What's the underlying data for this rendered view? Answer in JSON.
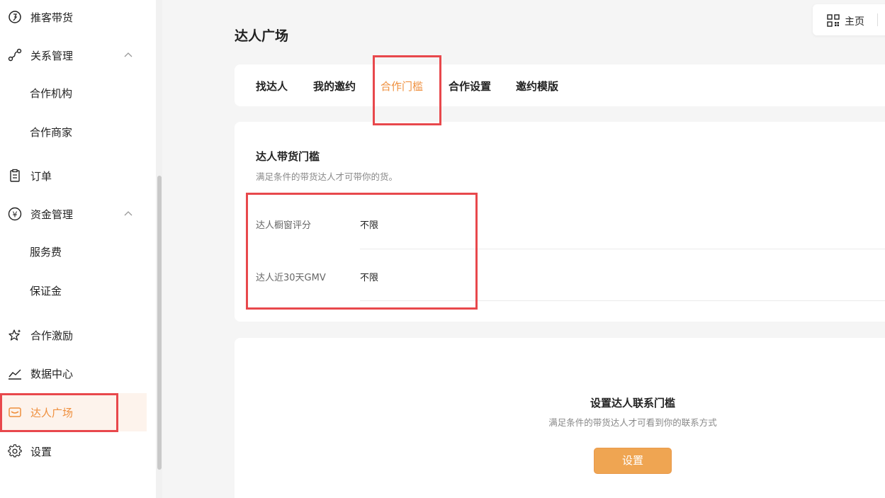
{
  "sidebar": {
    "items": [
      {
        "label": "推客带货",
        "icon": "bulb-icon"
      },
      {
        "label": "关系管理",
        "icon": "relation-icon"
      },
      {
        "label": "合作机构"
      },
      {
        "label": "合作商家"
      },
      {
        "label": "订单",
        "icon": "clipboard-icon"
      },
      {
        "label": "资金管理",
        "icon": "yen-icon"
      },
      {
        "label": "服务费"
      },
      {
        "label": "保证金"
      },
      {
        "label": "合作激励",
        "icon": "star-sparkle-icon"
      },
      {
        "label": "数据中心",
        "icon": "trend-icon"
      },
      {
        "label": "达人广场",
        "icon": "mail-icon",
        "active": true
      },
      {
        "label": "设置",
        "icon": "gear-icon"
      }
    ]
  },
  "header": {
    "title": "达人广场",
    "home_label": "主页"
  },
  "tabs": [
    {
      "label": "找达人"
    },
    {
      "label": "我的邀约"
    },
    {
      "label": "合作门槛",
      "active": true
    },
    {
      "label": "合作设置"
    },
    {
      "label": "邀约模版"
    }
  ],
  "threshold": {
    "title": "达人带货门槛",
    "description": "满足条件的带货达人才可带你的货。",
    "rows": [
      {
        "label": "达人橱窗评分",
        "value": "不限"
      },
      {
        "label": "达人近30天GMV",
        "value": "不限"
      }
    ]
  },
  "contact": {
    "title": "设置达人联系门槛",
    "description": "满足条件的带货达人才可看到你的联系方式",
    "button_label": "设置"
  },
  "colors": {
    "accent": "#ef8f3d",
    "button": "#efa552",
    "highlight": "#e8484c"
  }
}
